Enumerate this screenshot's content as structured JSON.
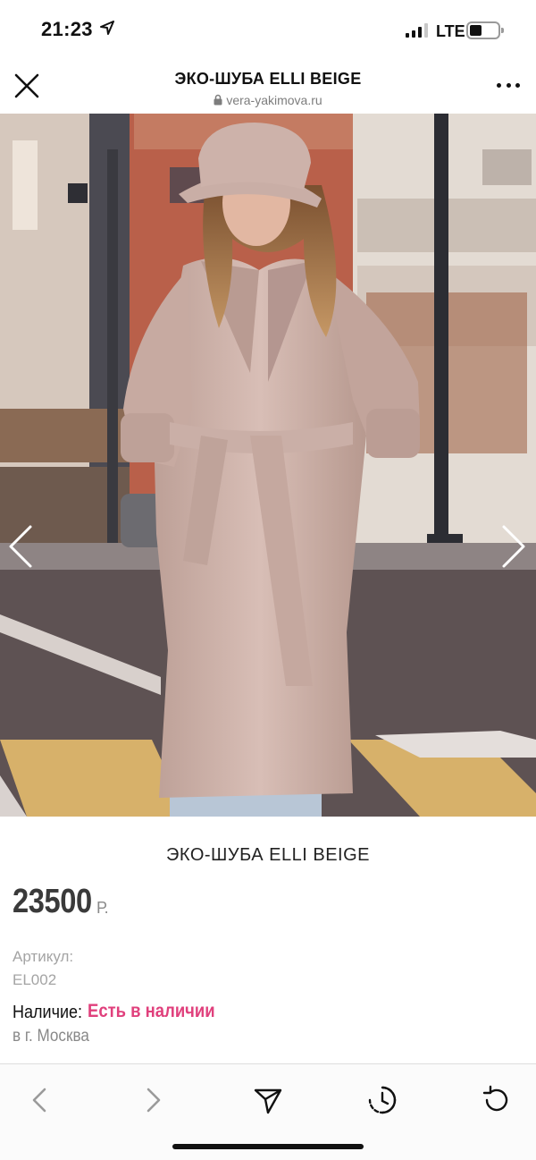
{
  "status_bar": {
    "time": "21:23",
    "network": "LTE",
    "icons": [
      "location-arrow-icon",
      "signal-icon",
      "battery-icon"
    ]
  },
  "header": {
    "title": "ЭКО-ШУБА ELLI BEIGE",
    "url": "vera-yakimova.ru",
    "icons": [
      "close-icon",
      "lock-icon",
      "more-icon"
    ]
  },
  "gallery": {
    "image_alt": "woman in beige faux fur coat and hat on city street",
    "icons": [
      "chevron-left-icon",
      "chevron-right-icon"
    ]
  },
  "product": {
    "title": "ЭКО-ШУБА ELLI BEIGE",
    "price": "23500",
    "currency": "Р.",
    "sku_label": "Артикул:",
    "sku_value": "EL002",
    "availability_label": "Наличие:",
    "availability_value": "Есть в наличии",
    "city": "в г. Москва"
  },
  "toolbar": {
    "icons": [
      "back-icon",
      "forward-icon",
      "share-icon",
      "history-icon",
      "reload-icon"
    ]
  },
  "colors": {
    "accent": "#e0407c",
    "coat": "#c9aea6",
    "text": "#111111",
    "muted": "#a4a4a4"
  }
}
